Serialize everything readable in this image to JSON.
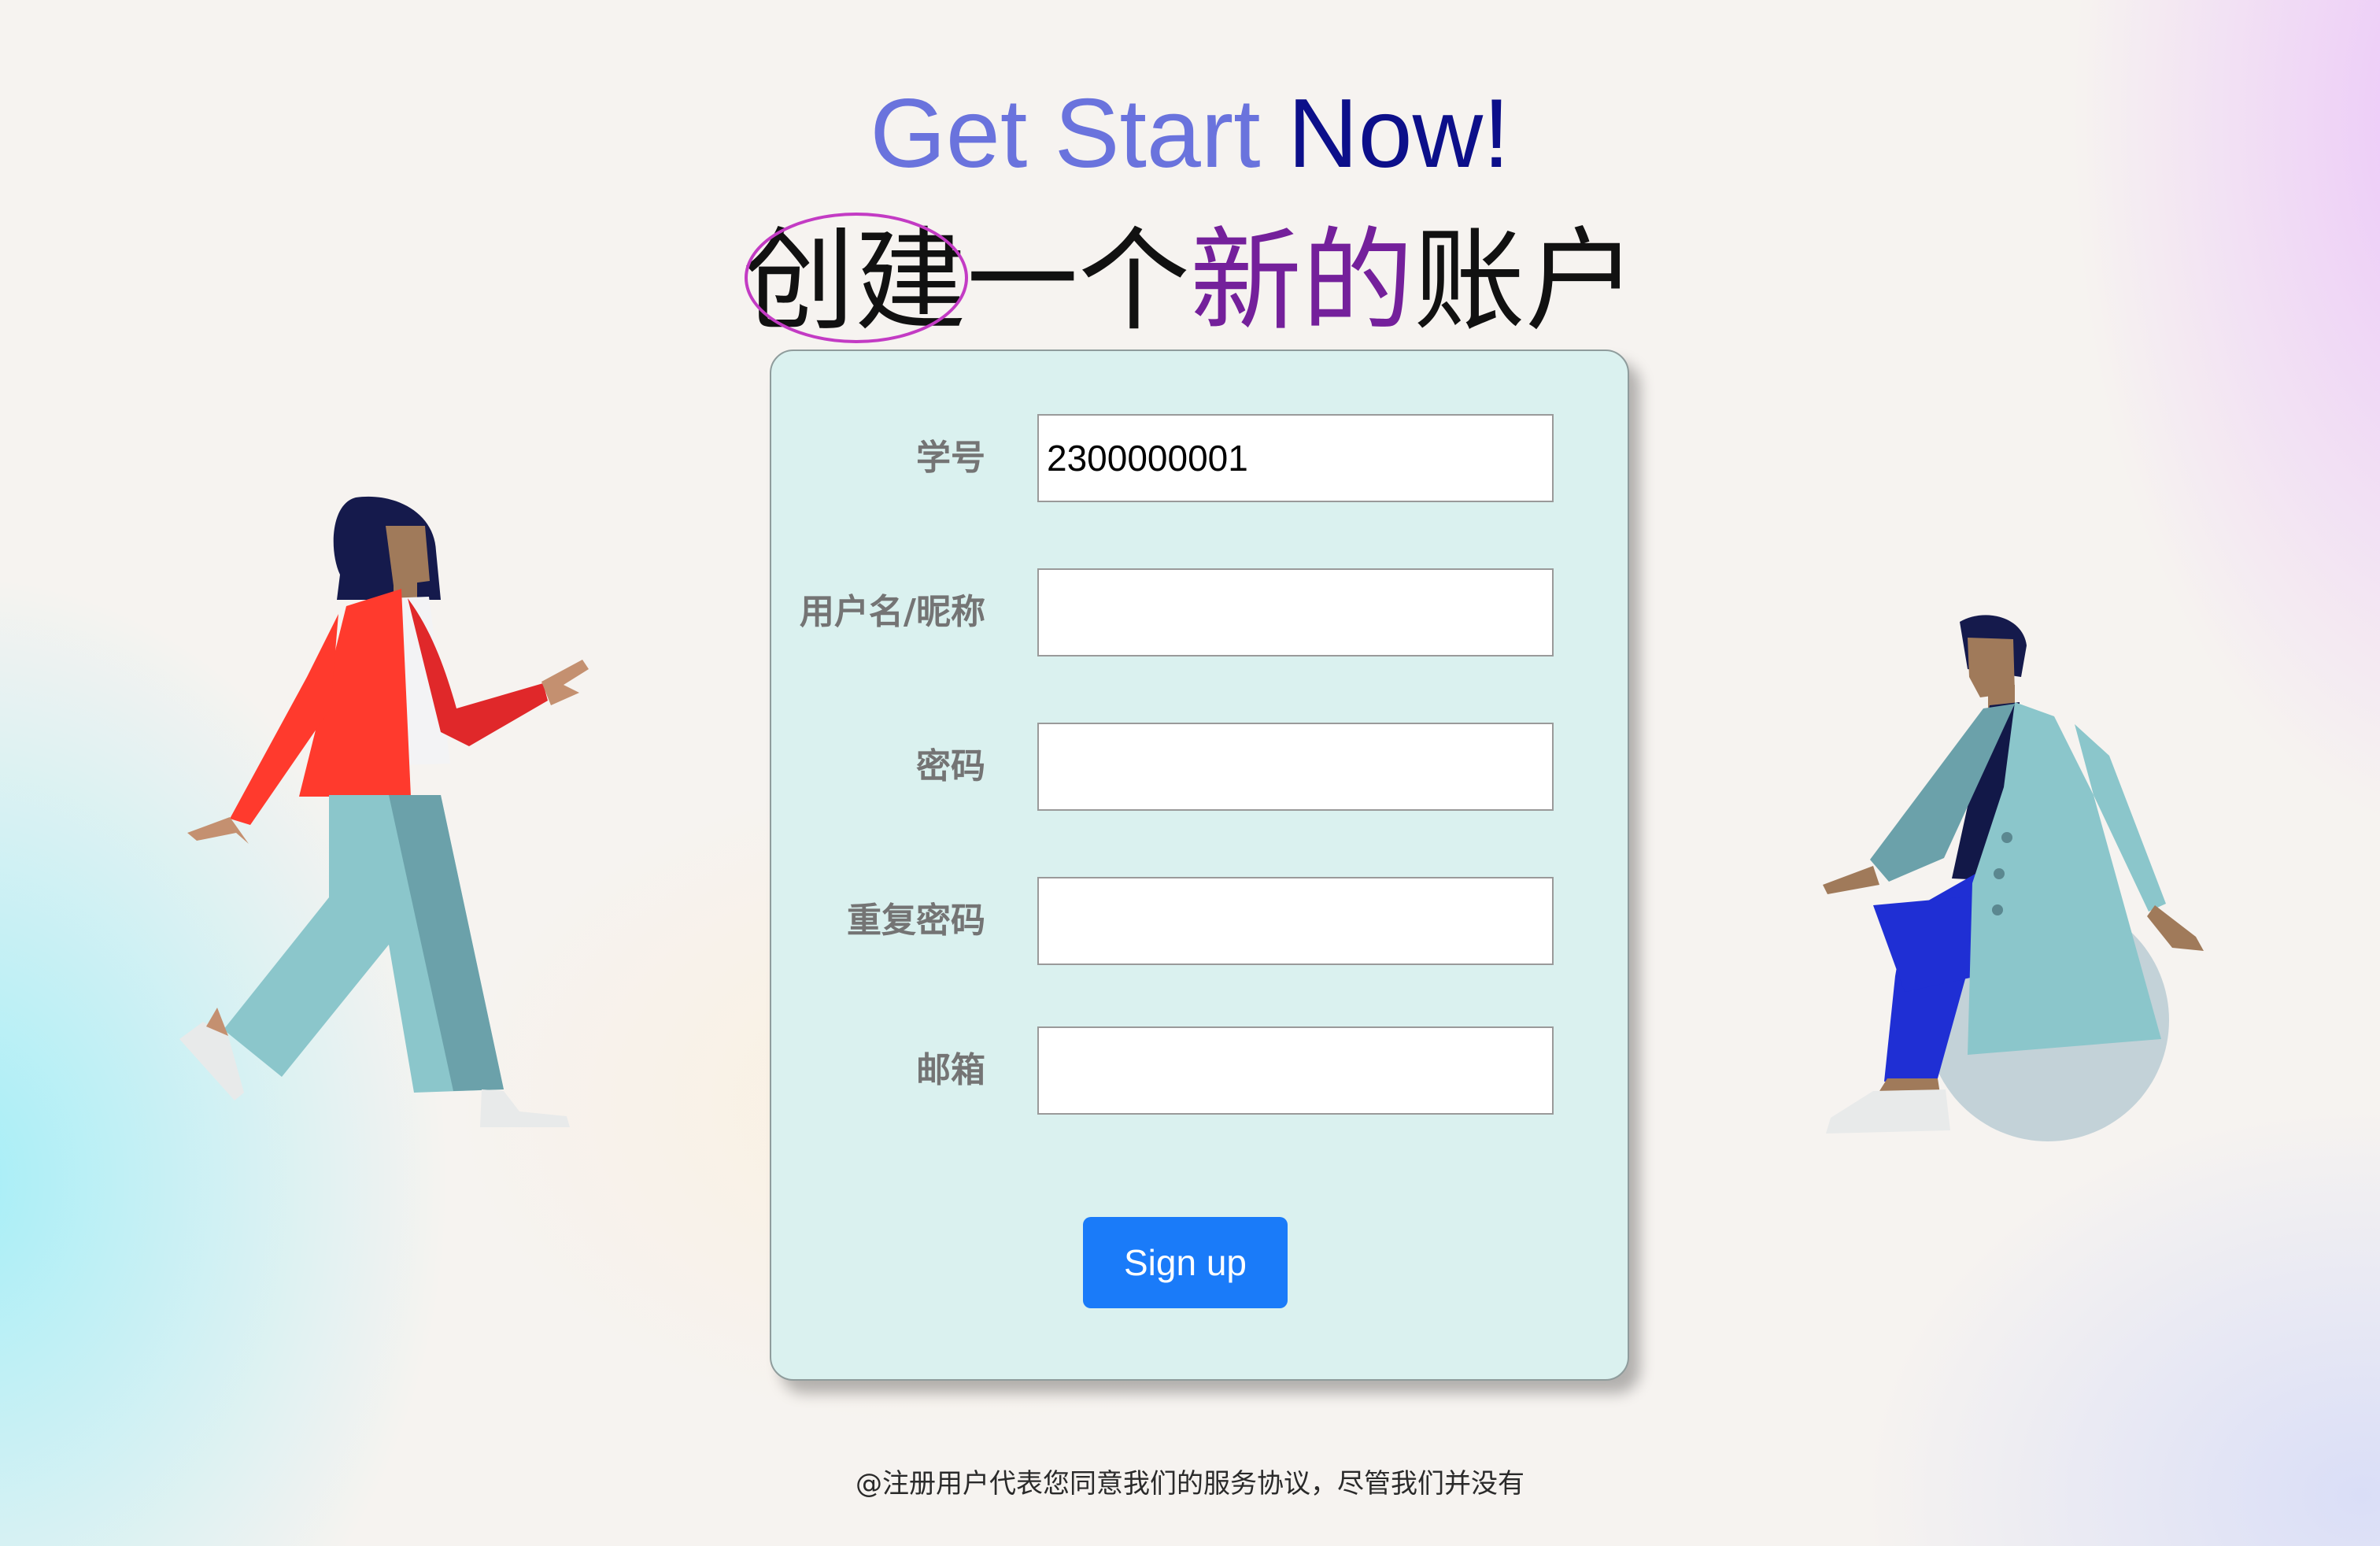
{
  "header": {
    "title_part1": "Get Start ",
    "title_part2": "Now!",
    "subtitle_part1": "创建一个",
    "subtitle_highlight": "新的",
    "subtitle_part2": "账户"
  },
  "form": {
    "fields": [
      {
        "label": "学号",
        "value": "2300000001",
        "placeholder": ""
      },
      {
        "label": "用户名/昵称",
        "value": "",
        "placeholder": ""
      },
      {
        "label": "密码",
        "value": "",
        "placeholder": ""
      },
      {
        "label": "重复密码",
        "value": "",
        "placeholder": ""
      },
      {
        "label": "邮箱",
        "value": "",
        "placeholder": ""
      }
    ],
    "submit_label": "Sign up"
  },
  "footer": {
    "note": "@注册用户代表您同意我们的服务协议，尽管我们并没有"
  },
  "illustrations": {
    "left": "walking-woman-illustration",
    "right": "sitting-man-illustration"
  },
  "colors": {
    "title_light": "#6a73dd",
    "title_dark": "#0c0f8a",
    "highlight": "#74209b",
    "circle_mark": "#c33bc4",
    "card_bg": "#daf1ef",
    "button": "#1a7bf9"
  }
}
